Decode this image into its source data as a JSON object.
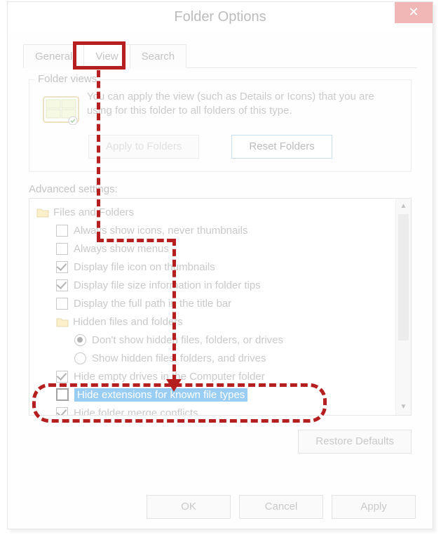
{
  "window": {
    "title": "Folder Options",
    "close_glyph": "✕"
  },
  "tabs": {
    "general": "General",
    "view": "View",
    "search": "Search"
  },
  "folder_views": {
    "legend": "Folder views",
    "text": "You can apply the view (such as Details or Icons) that you are using for this folder to all folders of this type.",
    "apply": "Apply to Folders",
    "reset": "Reset Folders"
  },
  "advanced": {
    "label": "Advanced settings:",
    "root": "Files and Folders",
    "items": {
      "i0": "Always show icons, never thumbnails",
      "i1": "Always show menus",
      "i2": "Display file icon on thumbnails",
      "i3": "Display file size information in folder tips",
      "i4": "Display the full path in the title bar",
      "i5": "Hidden files and folders",
      "i5a": "Don't show hidden files, folders, or drives",
      "i5b": "Show hidden files, folders, and drives",
      "i6": "Hide empty drives in the Computer folder",
      "i7": "Hide extensions for known file types",
      "i8": "Hide folder merge conflicts"
    },
    "restore": "Restore Defaults"
  },
  "buttons": {
    "ok": "OK",
    "cancel": "Cancel",
    "apply": "Apply"
  },
  "scrollbar": {
    "up": "▲",
    "down": "▼"
  }
}
